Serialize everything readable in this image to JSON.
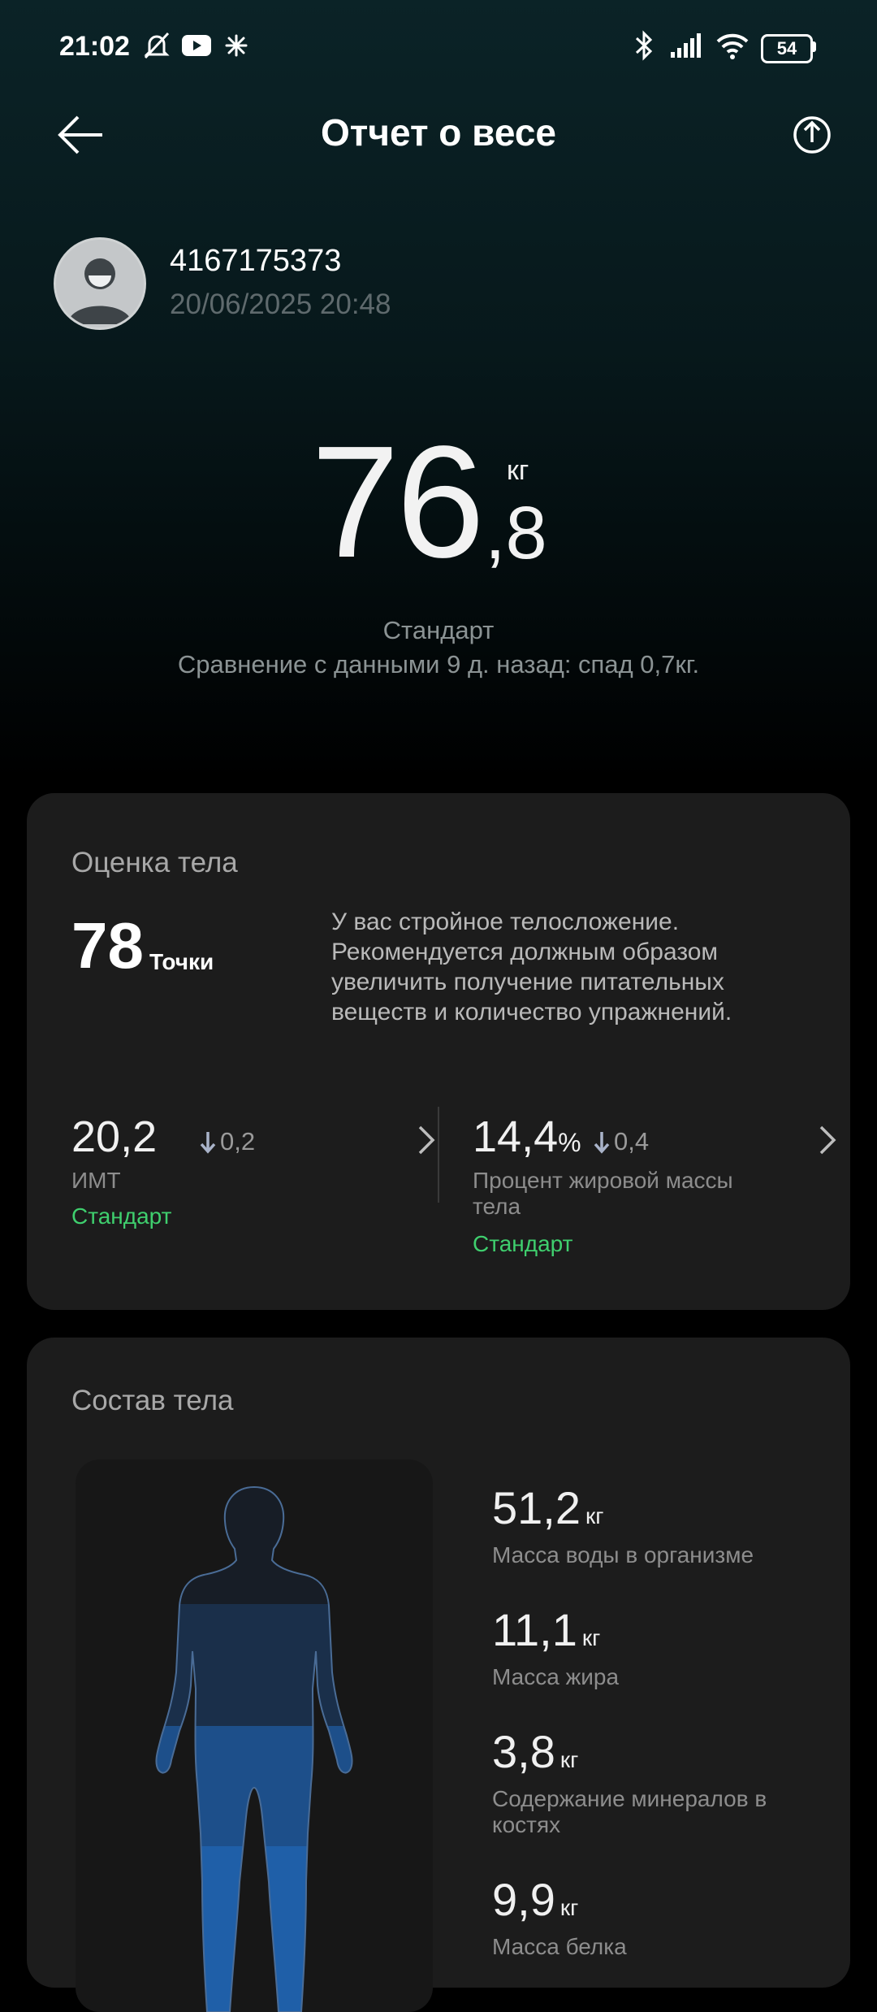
{
  "status_bar": {
    "time": "21:02",
    "battery": "54"
  },
  "header": {
    "title": "Отчет о весе"
  },
  "profile": {
    "name": "4167175373",
    "datetime": "20/06/2025 20:48"
  },
  "weight": {
    "integer": "76",
    "decimal": ",8",
    "unit": "кг",
    "status": "Стандарт",
    "comparison": "Сравнение с данными 9 д. назад: спад 0,7кг."
  },
  "body_score": {
    "title": "Оценка тела",
    "score": "78",
    "score_unit": "Точки",
    "description": "У вас стройное телосложение. Рекомендуется должным образом увеличить получение питательных веществ и количество упражнений."
  },
  "metrics": [
    {
      "value": "20,2",
      "unit": "",
      "delta": "0,2",
      "label": "ИМТ",
      "status": "Стандарт"
    },
    {
      "value": "14,4",
      "unit": "%",
      "delta": "0,4",
      "label": "Процент жировой массы тела",
      "status": "Стандарт"
    }
  ],
  "composition": {
    "title": "Состав тела",
    "items": [
      {
        "value": "51,2",
        "unit": "кг",
        "label": "Масса воды в организме"
      },
      {
        "value": "11,1",
        "unit": "кг",
        "label": "Масса жира"
      },
      {
        "value": "3,8",
        "unit": "кг",
        "label": "Содержание минералов в костях"
      },
      {
        "value": "9,9",
        "unit": "кг",
        "label": "Масса белка"
      }
    ]
  },
  "colors": {
    "accent_green": "#3fcf6e",
    "card_bg": "#1c1c1c",
    "body_blue": "#1f5fa8"
  }
}
